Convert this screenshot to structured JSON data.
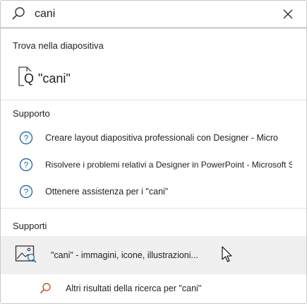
{
  "search": {
    "value": "cani"
  },
  "find_section": {
    "title": "Trova nella diapositiva",
    "item": {
      "q": "Q",
      "text": "\"cani\""
    }
  },
  "support_section": {
    "title": "Supporto",
    "items": [
      {
        "label": "Creare layout diapositiva professionali con Designer - Micro"
      },
      {
        "label": "Risolvere i problemi relativi a Designer in PowerPoint - Microsoft Su..."
      },
      {
        "label": "Ottenere assistenza per i \"cani\""
      }
    ]
  },
  "media_section": {
    "title": "Supporti",
    "item": {
      "label": "\"cani\" - immagini, icone, illustrazioni..."
    }
  },
  "more_results": {
    "label": "Altri risultati della ricerca per \"cani\""
  },
  "colors": {
    "accent_blue": "#2b6cb0",
    "search_orange": "#c0562a"
  }
}
